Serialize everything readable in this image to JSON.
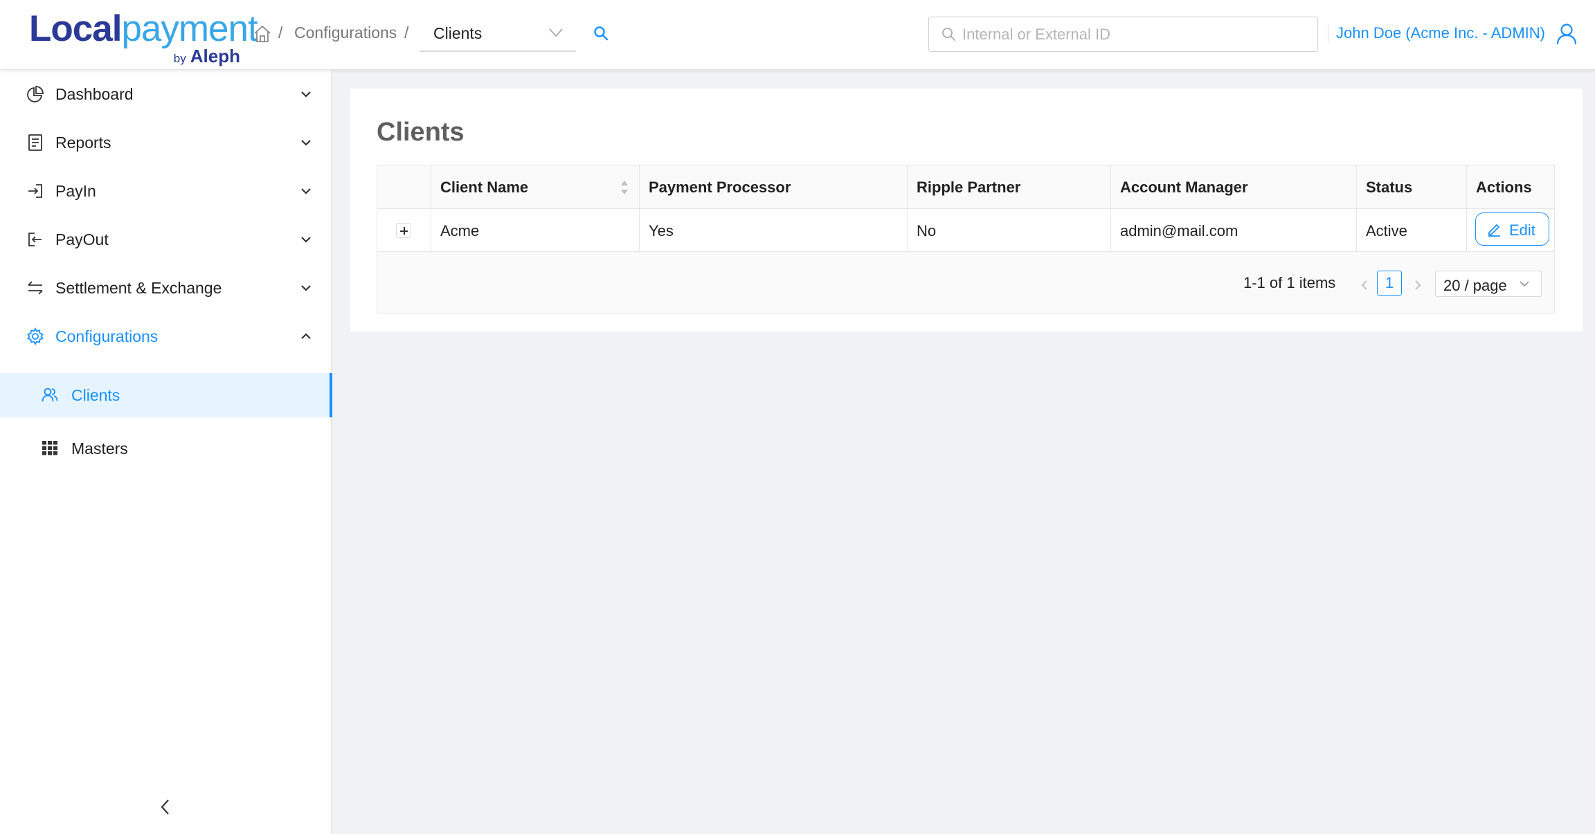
{
  "brand": {
    "name_part1": "Local",
    "name_part2": "payment",
    "sub_by": "by",
    "sub_brand": "Aleph"
  },
  "breadcrumb": {
    "separator": "/",
    "section": "Configurations",
    "current": "Clients"
  },
  "top_search": {
    "placeholder": "Internal or External ID"
  },
  "user": {
    "label": "John Doe (Acme Inc. - ADMIN)"
  },
  "sidebar": {
    "items": [
      {
        "label": "Dashboard",
        "icon": "pie-chart-icon"
      },
      {
        "label": "Reports",
        "icon": "document-icon"
      },
      {
        "label": "PayIn",
        "icon": "login-icon"
      },
      {
        "label": "PayOut",
        "icon": "logout-icon"
      },
      {
        "label": "Settlement & Exchange",
        "icon": "swap-icon"
      },
      {
        "label": "Configurations",
        "icon": "gear-icon"
      }
    ],
    "subitems": [
      {
        "label": "Clients",
        "icon": "users-icon"
      },
      {
        "label": "Masters",
        "icon": "grid-icon"
      }
    ]
  },
  "page": {
    "title": "Clients"
  },
  "table": {
    "columns": [
      "",
      "Client Name",
      "Payment Processor",
      "Ripple Partner",
      "Account Manager",
      "Status",
      "Actions"
    ],
    "rows": [
      {
        "client_name": "Acme",
        "payment_processor": "Yes",
        "ripple_partner": "No",
        "account_manager": "admin@mail.com",
        "status": "Active",
        "action_label": "Edit"
      }
    ]
  },
  "pagination": {
    "total_text": "1-1 of 1 items",
    "current_page": "1",
    "page_size": "20 / page"
  },
  "colors": {
    "accent": "#1890ff",
    "brand_dark": "#2b3a97",
    "brand_light": "#38a6e8",
    "active_bg": "#e6f4ff"
  }
}
